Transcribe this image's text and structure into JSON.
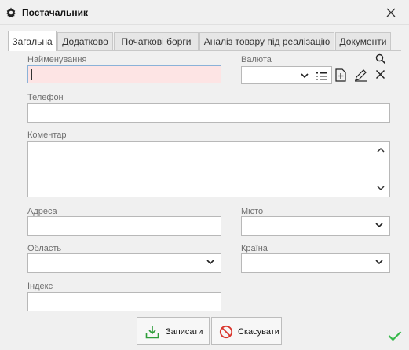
{
  "window": {
    "title": "Постачальник"
  },
  "tabs": [
    {
      "label": "Загальна",
      "active": true
    },
    {
      "label": "Додатково"
    },
    {
      "label": "Початкові борги"
    },
    {
      "label": "Аналіз товару під реалізацію"
    },
    {
      "label": "Документи"
    }
  ],
  "form": {
    "name_label": "Найменування",
    "name_value": "",
    "currency_label": "Валюта",
    "currency_value": "",
    "phone_label": "Телефон",
    "phone_value": "",
    "comment_label": "Коментар",
    "comment_value": "",
    "address_label": "Адреса",
    "address_value": "",
    "city_label": "Місто",
    "city_value": "",
    "region_label": "Область",
    "region_value": "",
    "country_label": "Країна",
    "country_value": "",
    "index_label": "Індекс",
    "index_value": ""
  },
  "buttons": {
    "save_label": "Записати",
    "cancel_label": "Скасувати"
  },
  "colors": {
    "required_field_bg": "#fde4e4",
    "save_icon": "#2e9d3a",
    "cancel_icon": "#d9342b",
    "ok_check": "#36b84a"
  }
}
